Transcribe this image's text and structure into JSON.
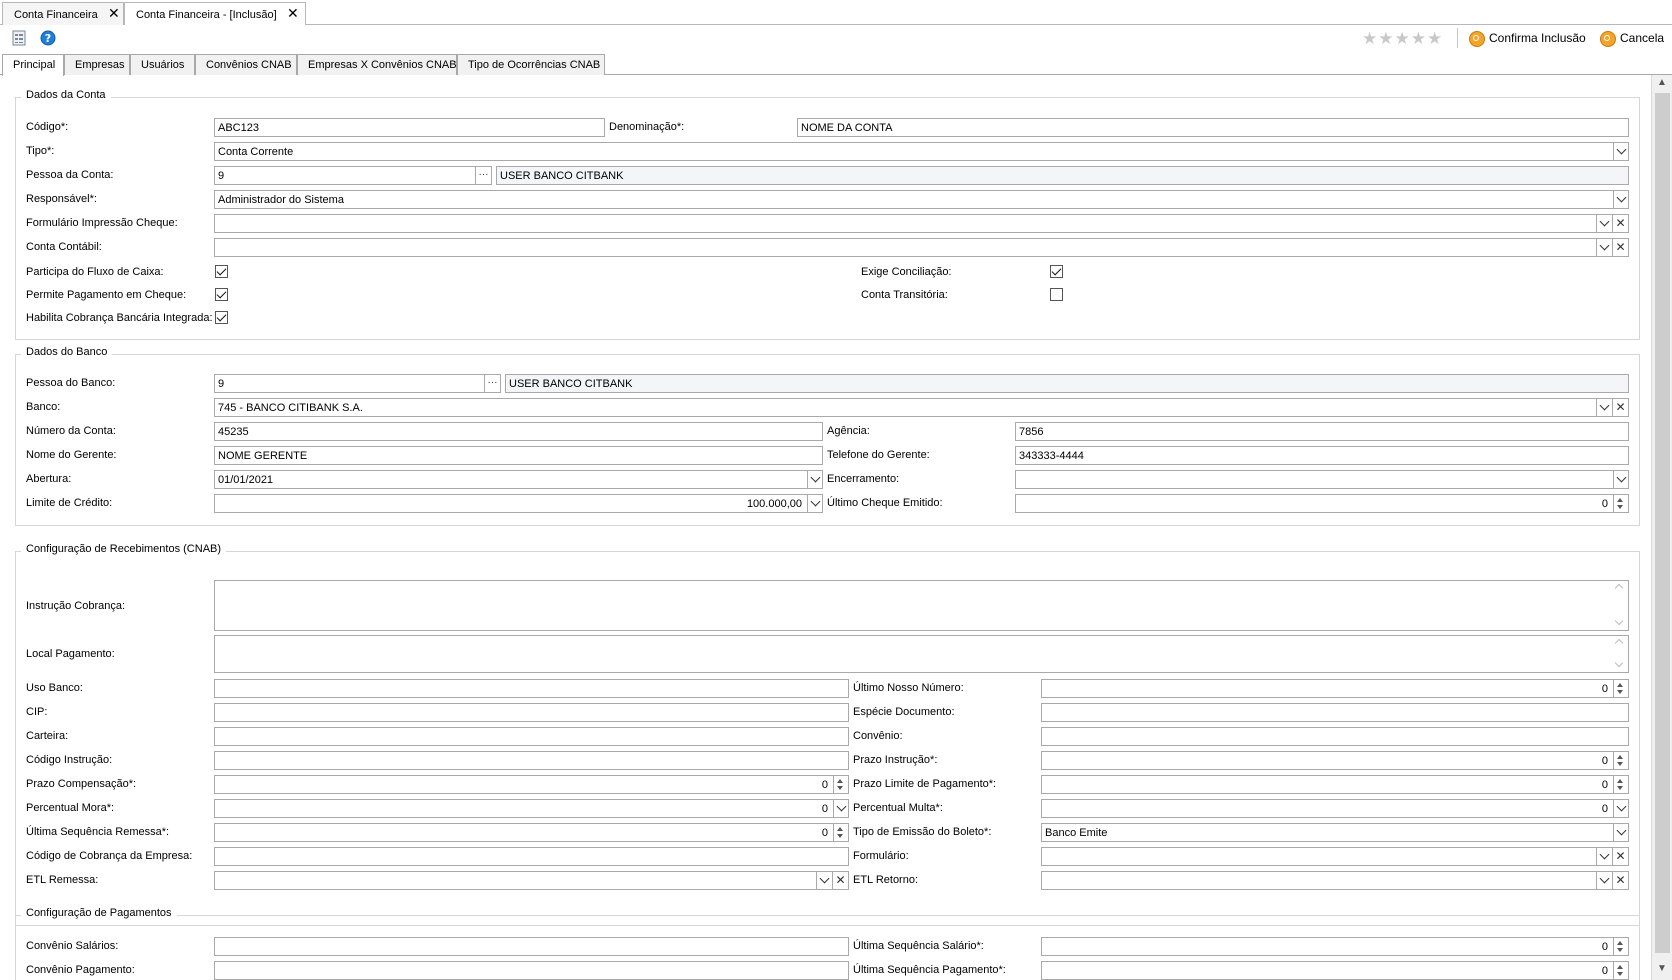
{
  "doc_tabs": [
    {
      "label": "Conta Financeira"
    },
    {
      "label": "Conta Financeira - [Inclusão]"
    }
  ],
  "toolbar": {
    "stars": "★★★★★",
    "confirm_label": "Confirma Inclusão",
    "cancel_label": "Cancela"
  },
  "page_tabs": [
    "Principal",
    "Empresas",
    "Usuários",
    "Convênios CNAB",
    "Empresas X Convênios CNAB",
    "Tipo de Ocorrências CNAB"
  ],
  "dados_conta": {
    "legend": "Dados da Conta",
    "codigo_label": "Código*:",
    "codigo_value": "ABC123",
    "denominacao_label": "Denominação*:",
    "denominacao_value": "NOME DA CONTA",
    "tipo_label": "Tipo*:",
    "tipo_value": "Conta Corrente",
    "pessoa_label": "Pessoa da Conta:",
    "pessoa_code": "9",
    "pessoa_name": "USER BANCO CITBANK",
    "responsavel_label": "Responsável*:",
    "responsavel_value": "Administrador do Sistema",
    "formulario_label": "Formulário Impressão Cheque:",
    "formulario_value": "",
    "contabil_label": "Conta Contábil:",
    "contabil_value": "",
    "fluxo_label": "Participa do Fluxo de Caixa:",
    "cheque_label": "Permite Pagamento em Cheque:",
    "cobranca_label": "Habilita Cobrança Bancária Integrada:",
    "conciliacao_label": "Exige Conciliação:",
    "transitoria_label": "Conta Transitória:",
    "ellipsis": "···"
  },
  "dados_banco": {
    "legend": "Dados do Banco",
    "pessoa_label": "Pessoa do Banco:",
    "pessoa_code": "9",
    "pessoa_name": "USER BANCO CITBANK",
    "banco_label": "Banco:",
    "banco_value": "745 - BANCO CITIBANK S.A.",
    "numero_label": "Número da Conta:",
    "numero_value": "45235",
    "agencia_label": "Agência:",
    "agencia_value": "7856",
    "gerente_label": "Nome do Gerente:",
    "gerente_value": "NOME GERENTE",
    "telefone_label": "Telefone do Gerente:",
    "telefone_value": "343333-4444",
    "abertura_label": "Abertura:",
    "abertura_value": "01/01/2021",
    "encerramento_label": "Encerramento:",
    "encerramento_value": "",
    "limite_label": "Limite de Crédito:",
    "limite_value": "100.000,00",
    "ultimo_cheque_label": "Último Cheque Emitido:",
    "ultimo_cheque_value": "0"
  },
  "cnab": {
    "legend": "Configuração de Recebimentos (CNAB)",
    "instrucao_label": "Instrução Cobrança:",
    "local_label": "Local Pagamento:",
    "uso_banco_label": "Uso Banco:",
    "nosso_numero_label": "Último Nosso Número:",
    "nosso_numero_value": "0",
    "cip_label": "CIP:",
    "especie_label": "Espécie Documento:",
    "carteira_label": "Carteira:",
    "convenio_label": "Convênio:",
    "codigo_instrucao_label": "Código Instrução:",
    "prazo_instrucao_label": "Prazo Instrução*:",
    "prazo_instrucao_value": "0",
    "prazo_compensacao_label": "Prazo Compensação*:",
    "prazo_compensacao_value": "0",
    "prazo_limite_label": "Prazo Limite de Pagamento*:",
    "prazo_limite_value": "0",
    "perc_mora_label": "Percentual Mora*:",
    "perc_mora_value": "0",
    "perc_multa_label": "Percentual Multa*:",
    "perc_multa_value": "0",
    "ult_seq_label": "Última Sequência Remessa*:",
    "ult_seq_value": "0",
    "tipo_emissao_label": "Tipo de Emissão do Boleto*:",
    "tipo_emissao_value": "Banco Emite",
    "cod_cobranca_label": "Código de Cobrança da Empresa:",
    "formulario_label": "Formulário:",
    "etl_remessa_label": "ETL Remessa:",
    "etl_retorno_label": "ETL Retorno:"
  },
  "pagamentos": {
    "legend": "Configuração de Pagamentos",
    "convenio_salarios_label": "Convênio Salários:",
    "ult_seq_salario_label": "Última Sequência Salário*:",
    "ult_seq_salario_value": "0",
    "convenio_pagamento_label": "Convênio Pagamento:",
    "ult_seq_pagamento_label": "Última Sequência Pagamento*:",
    "ult_seq_pagamento_value": "0"
  }
}
